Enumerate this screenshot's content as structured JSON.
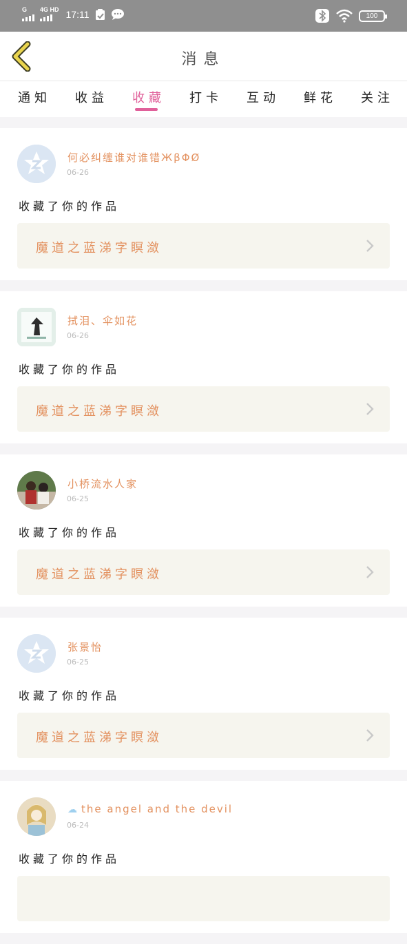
{
  "status_bar": {
    "signal1_label": "G",
    "signal2_label": "4G HD",
    "time": "17:11",
    "battery": "100"
  },
  "header": {
    "title": "消息"
  },
  "tabs": [
    {
      "label": "通知"
    },
    {
      "label": "收益"
    },
    {
      "label": "收藏",
      "active": true
    },
    {
      "label": "打卡"
    },
    {
      "label": "互动"
    },
    {
      "label": "鲜花"
    },
    {
      "label": "关注"
    }
  ],
  "feed": [
    {
      "user": "何必纠缠谁对谁错ЖβΦØ",
      "date": "06-26",
      "action": "收藏了你的作品",
      "work": "魔道之蓝涕字瞑潋",
      "avatar": "default-avatar"
    },
    {
      "user": "拭泪、伞如花",
      "date": "06-26",
      "action": "收藏了你的作品",
      "work": "魔道之蓝涕字瞑潋",
      "avatar": "photo-avatar"
    },
    {
      "user": "小桥流水人家",
      "date": "06-25",
      "action": "收藏了你的作品",
      "work": "魔道之蓝涕字瞑潋",
      "avatar": "photo-avatar"
    },
    {
      "user": "张景怡",
      "date": "06-25",
      "action": "收藏了你的作品",
      "work": "魔道之蓝涕字瞑潋",
      "avatar": "default-avatar"
    },
    {
      "user": "the angel and the devil",
      "date": "06-24",
      "action": "收藏了你的作品",
      "work": "",
      "avatar": "photo-avatar"
    }
  ],
  "colors": {
    "accent": "#e0609a",
    "name_orange": "#e3915f",
    "status_bar": "#8f8f8f"
  }
}
